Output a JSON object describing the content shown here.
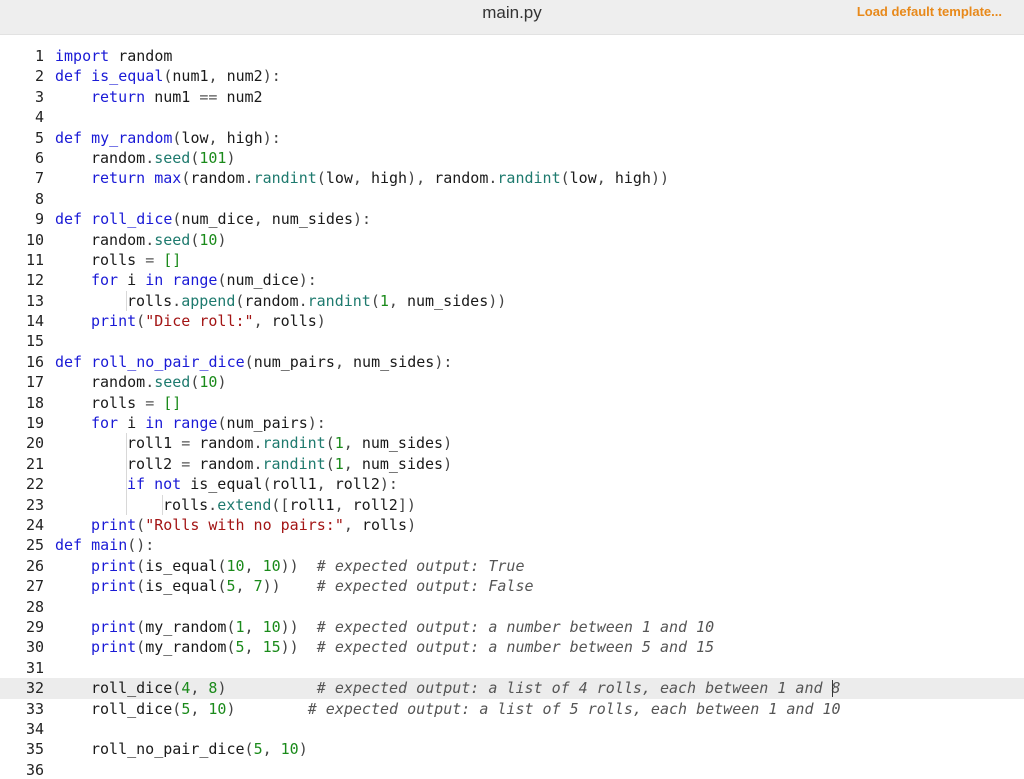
{
  "header": {
    "file_name": "main.py",
    "load_template_label": "Load default template..."
  },
  "editor": {
    "active_line": 32,
    "lines": [
      {
        "n": "1",
        "indent": 0,
        "tokens": [
          [
            "kw",
            "import"
          ],
          [
            "txt",
            " random"
          ]
        ]
      },
      {
        "n": "2",
        "indent": 0,
        "tokens": [
          [
            "def",
            "def"
          ],
          [
            "txt",
            " "
          ],
          [
            "fn",
            "is_equal"
          ],
          [
            "punc",
            "("
          ],
          [
            "txt",
            "num1"
          ],
          [
            "punc",
            ", "
          ],
          [
            "txt",
            "num2"
          ],
          [
            "punc",
            "):"
          ]
        ]
      },
      {
        "n": "3",
        "indent": 1,
        "tokens": [
          [
            "kw",
            "return"
          ],
          [
            "txt",
            " num1 "
          ],
          [
            "op",
            "=="
          ],
          [
            "txt",
            " num2"
          ]
        ]
      },
      {
        "n": "4",
        "indent": 0,
        "tokens": []
      },
      {
        "n": "5",
        "indent": 0,
        "tokens": [
          [
            "def",
            "def"
          ],
          [
            "txt",
            " "
          ],
          [
            "fn",
            "my_random"
          ],
          [
            "punc",
            "("
          ],
          [
            "txt",
            "low"
          ],
          [
            "punc",
            ", "
          ],
          [
            "txt",
            "high"
          ],
          [
            "punc",
            "):"
          ]
        ]
      },
      {
        "n": "6",
        "indent": 1,
        "tokens": [
          [
            "txt",
            "random"
          ],
          [
            "punc",
            "."
          ],
          [
            "attr",
            "seed"
          ],
          [
            "punc",
            "("
          ],
          [
            "num",
            "101"
          ],
          [
            "punc",
            ")"
          ]
        ]
      },
      {
        "n": "7",
        "indent": 1,
        "tokens": [
          [
            "kw",
            "return"
          ],
          [
            "txt",
            " "
          ],
          [
            "builtin",
            "max"
          ],
          [
            "punc",
            "("
          ],
          [
            "txt",
            "random"
          ],
          [
            "punc",
            "."
          ],
          [
            "attr",
            "randint"
          ],
          [
            "punc",
            "("
          ],
          [
            "txt",
            "low"
          ],
          [
            "punc",
            ", "
          ],
          [
            "txt",
            "high"
          ],
          [
            "punc",
            "), "
          ],
          [
            "txt",
            "random"
          ],
          [
            "punc",
            "."
          ],
          [
            "attr",
            "randint"
          ],
          [
            "punc",
            "("
          ],
          [
            "txt",
            "low"
          ],
          [
            "punc",
            ", "
          ],
          [
            "txt",
            "high"
          ],
          [
            "punc",
            "))"
          ]
        ]
      },
      {
        "n": "8",
        "indent": 0,
        "tokens": []
      },
      {
        "n": "9",
        "indent": 0,
        "tokens": [
          [
            "def",
            "def"
          ],
          [
            "txt",
            " "
          ],
          [
            "fn",
            "roll_dice"
          ],
          [
            "punc",
            "("
          ],
          [
            "txt",
            "num_dice"
          ],
          [
            "punc",
            ", "
          ],
          [
            "txt",
            "num_sides"
          ],
          [
            "punc",
            "):"
          ]
        ]
      },
      {
        "n": "10",
        "indent": 1,
        "tokens": [
          [
            "txt",
            "random"
          ],
          [
            "punc",
            "."
          ],
          [
            "attr",
            "seed"
          ],
          [
            "punc",
            "("
          ],
          [
            "num",
            "10"
          ],
          [
            "punc",
            ")"
          ]
        ]
      },
      {
        "n": "11",
        "indent": 1,
        "tokens": [
          [
            "txt",
            "rolls "
          ],
          [
            "op",
            "="
          ],
          [
            "txt",
            " "
          ],
          [
            "bracket",
            "[]"
          ]
        ]
      },
      {
        "n": "12",
        "indent": 1,
        "tokens": [
          [
            "kw",
            "for"
          ],
          [
            "txt",
            " i "
          ],
          [
            "kw",
            "in"
          ],
          [
            "txt",
            " "
          ],
          [
            "builtin",
            "range"
          ],
          [
            "punc",
            "("
          ],
          [
            "txt",
            "num_dice"
          ],
          [
            "punc",
            "):"
          ]
        ]
      },
      {
        "n": "13",
        "indent": 2,
        "tokens": [
          [
            "txt",
            "rolls"
          ],
          [
            "punc",
            "."
          ],
          [
            "attr",
            "append"
          ],
          [
            "punc",
            "("
          ],
          [
            "txt",
            "random"
          ],
          [
            "punc",
            "."
          ],
          [
            "attr",
            "randint"
          ],
          [
            "punc",
            "("
          ],
          [
            "num",
            "1"
          ],
          [
            "punc",
            ", "
          ],
          [
            "txt",
            "num_sides"
          ],
          [
            "punc",
            "))"
          ]
        ]
      },
      {
        "n": "14",
        "indent": 1,
        "tokens": [
          [
            "builtin",
            "print"
          ],
          [
            "punc",
            "("
          ],
          [
            "str",
            "\"Dice roll:\""
          ],
          [
            "punc",
            ", "
          ],
          [
            "txt",
            "rolls"
          ],
          [
            "punc",
            ")"
          ]
        ]
      },
      {
        "n": "15",
        "indent": 0,
        "tokens": []
      },
      {
        "n": "16",
        "indent": 0,
        "tokens": [
          [
            "def",
            "def"
          ],
          [
            "txt",
            " "
          ],
          [
            "fn",
            "roll_no_pair_dice"
          ],
          [
            "punc",
            "("
          ],
          [
            "txt",
            "num_pairs"
          ],
          [
            "punc",
            ", "
          ],
          [
            "txt",
            "num_sides"
          ],
          [
            "punc",
            "):"
          ]
        ]
      },
      {
        "n": "17",
        "indent": 1,
        "tokens": [
          [
            "txt",
            "random"
          ],
          [
            "punc",
            "."
          ],
          [
            "attr",
            "seed"
          ],
          [
            "punc",
            "("
          ],
          [
            "num",
            "10"
          ],
          [
            "punc",
            ")"
          ]
        ]
      },
      {
        "n": "18",
        "indent": 1,
        "tokens": [
          [
            "txt",
            "rolls "
          ],
          [
            "op",
            "="
          ],
          [
            "txt",
            " "
          ],
          [
            "bracket",
            "[]"
          ]
        ]
      },
      {
        "n": "19",
        "indent": 1,
        "tokens": [
          [
            "kw",
            "for"
          ],
          [
            "txt",
            " i "
          ],
          [
            "kw",
            "in"
          ],
          [
            "txt",
            " "
          ],
          [
            "builtin",
            "range"
          ],
          [
            "punc",
            "("
          ],
          [
            "txt",
            "num_pairs"
          ],
          [
            "punc",
            "):"
          ]
        ]
      },
      {
        "n": "20",
        "indent": 2,
        "tokens": [
          [
            "txt",
            "roll1 "
          ],
          [
            "op",
            "="
          ],
          [
            "txt",
            " random"
          ],
          [
            "punc",
            "."
          ],
          [
            "attr",
            "randint"
          ],
          [
            "punc",
            "("
          ],
          [
            "num",
            "1"
          ],
          [
            "punc",
            ", "
          ],
          [
            "txt",
            "num_sides"
          ],
          [
            "punc",
            ")"
          ]
        ]
      },
      {
        "n": "21",
        "indent": 2,
        "tokens": [
          [
            "txt",
            "roll2 "
          ],
          [
            "op",
            "="
          ],
          [
            "txt",
            " random"
          ],
          [
            "punc",
            "."
          ],
          [
            "attr",
            "randint"
          ],
          [
            "punc",
            "("
          ],
          [
            "num",
            "1"
          ],
          [
            "punc",
            ", "
          ],
          [
            "txt",
            "num_sides"
          ],
          [
            "punc",
            ")"
          ]
        ]
      },
      {
        "n": "22",
        "indent": 2,
        "tokens": [
          [
            "kw",
            "if"
          ],
          [
            "txt",
            " "
          ],
          [
            "kw",
            "not"
          ],
          [
            "txt",
            " is_equal"
          ],
          [
            "punc",
            "("
          ],
          [
            "txt",
            "roll1"
          ],
          [
            "punc",
            ", "
          ],
          [
            "txt",
            "roll2"
          ],
          [
            "punc",
            "):"
          ]
        ]
      },
      {
        "n": "23",
        "indent": 3,
        "tokens": [
          [
            "txt",
            "rolls"
          ],
          [
            "punc",
            "."
          ],
          [
            "attr",
            "extend"
          ],
          [
            "punc",
            "(["
          ],
          [
            "txt",
            "roll1"
          ],
          [
            "punc",
            ", "
          ],
          [
            "txt",
            "roll2"
          ],
          [
            "punc",
            "])"
          ]
        ]
      },
      {
        "n": "24",
        "indent": 1,
        "tokens": [
          [
            "builtin",
            "print"
          ],
          [
            "punc",
            "("
          ],
          [
            "str",
            "\"Rolls with no pairs:\""
          ],
          [
            "punc",
            ", "
          ],
          [
            "txt",
            "rolls"
          ],
          [
            "punc",
            ")"
          ]
        ]
      },
      {
        "n": "25",
        "indent": 0,
        "tokens": [
          [
            "def",
            "def"
          ],
          [
            "txt",
            " "
          ],
          [
            "fn",
            "main"
          ],
          [
            "punc",
            "():"
          ]
        ]
      },
      {
        "n": "26",
        "indent": 1,
        "tokens": [
          [
            "builtin",
            "print"
          ],
          [
            "punc",
            "("
          ],
          [
            "txt",
            "is_equal"
          ],
          [
            "punc",
            "("
          ],
          [
            "num",
            "10"
          ],
          [
            "punc",
            ", "
          ],
          [
            "num",
            "10"
          ],
          [
            "punc",
            "))"
          ],
          [
            "txt",
            "  "
          ],
          [
            "com",
            "# expected output: True"
          ]
        ]
      },
      {
        "n": "27",
        "indent": 1,
        "tokens": [
          [
            "builtin",
            "print"
          ],
          [
            "punc",
            "("
          ],
          [
            "txt",
            "is_equal"
          ],
          [
            "punc",
            "("
          ],
          [
            "num",
            "5"
          ],
          [
            "punc",
            ", "
          ],
          [
            "num",
            "7"
          ],
          [
            "punc",
            "))"
          ],
          [
            "txt",
            "    "
          ],
          [
            "com",
            "# expected output: False"
          ]
        ]
      },
      {
        "n": "28",
        "indent": 0,
        "tokens": []
      },
      {
        "n": "29",
        "indent": 1,
        "tokens": [
          [
            "builtin",
            "print"
          ],
          [
            "punc",
            "("
          ],
          [
            "txt",
            "my_random"
          ],
          [
            "punc",
            "("
          ],
          [
            "num",
            "1"
          ],
          [
            "punc",
            ", "
          ],
          [
            "num",
            "10"
          ],
          [
            "punc",
            "))"
          ],
          [
            "txt",
            "  "
          ],
          [
            "com",
            "# expected output: a number between 1 and 10"
          ]
        ]
      },
      {
        "n": "30",
        "indent": 1,
        "tokens": [
          [
            "builtin",
            "print"
          ],
          [
            "punc",
            "("
          ],
          [
            "txt",
            "my_random"
          ],
          [
            "punc",
            "("
          ],
          [
            "num",
            "5"
          ],
          [
            "punc",
            ", "
          ],
          [
            "num",
            "15"
          ],
          [
            "punc",
            "))"
          ],
          [
            "txt",
            "  "
          ],
          [
            "com",
            "# expected output: a number between 5 and 15"
          ]
        ]
      },
      {
        "n": "31",
        "indent": 0,
        "tokens": []
      },
      {
        "n": "32",
        "indent": 1,
        "tokens": [
          [
            "txt",
            "roll_dice"
          ],
          [
            "punc",
            "("
          ],
          [
            "num",
            "4"
          ],
          [
            "punc",
            ", "
          ],
          [
            "num",
            "8"
          ],
          [
            "punc",
            ")"
          ],
          [
            "txt",
            "          "
          ],
          [
            "com",
            "# expected output: a list of 4 rolls, each between 1 and 8"
          ]
        ]
      },
      {
        "n": "33",
        "indent": 1,
        "tokens": [
          [
            "txt",
            "roll_dice"
          ],
          [
            "punc",
            "("
          ],
          [
            "num",
            "5"
          ],
          [
            "punc",
            ", "
          ],
          [
            "num",
            "10"
          ],
          [
            "punc",
            ")"
          ],
          [
            "txt",
            "        "
          ],
          [
            "com",
            "# expected output: a list of 5 rolls, each between 1 and 10"
          ]
        ]
      },
      {
        "n": "34",
        "indent": 0,
        "tokens": []
      },
      {
        "n": "35",
        "indent": 1,
        "tokens": [
          [
            "txt",
            "roll_no_pair_dice"
          ],
          [
            "punc",
            "("
          ],
          [
            "num",
            "5"
          ],
          [
            "punc",
            ", "
          ],
          [
            "num",
            "10"
          ],
          [
            "punc",
            ")"
          ]
        ]
      },
      {
        "n": "36",
        "indent": 0,
        "tokens": []
      }
    ]
  }
}
